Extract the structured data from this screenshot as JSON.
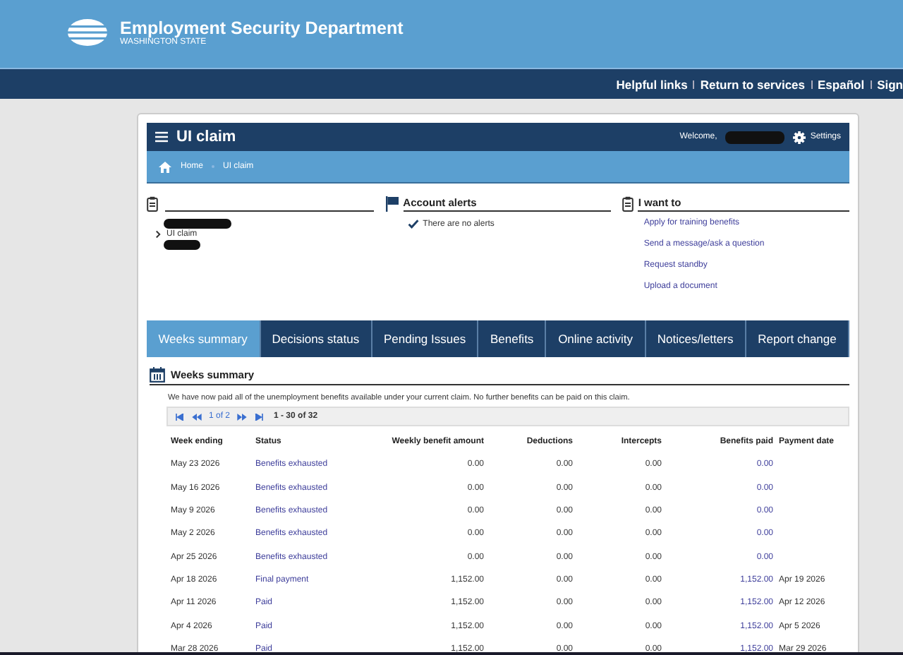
{
  "header": {
    "title": "Employment Security Department",
    "subtitle": "WASHINGTON STATE"
  },
  "top_links": [
    "Helpful links",
    "Return to services",
    "Español",
    "Sign"
  ],
  "claim_bar": {
    "title": "UI claim",
    "welcome": "Welcome,",
    "settings": "Settings"
  },
  "breadcrumb": [
    "Home",
    "UI claim"
  ],
  "account": {
    "claim_label": "UI claim"
  },
  "alerts": {
    "title": "Account alerts",
    "message": "There are no alerts"
  },
  "i_want_to": {
    "title": "I want to",
    "links": [
      "Apply for training benefits",
      "Send a message/ask a question",
      "Request standby",
      "Upload a document"
    ]
  },
  "tabs": [
    {
      "label": "Weeks summary",
      "selected": true
    },
    {
      "label": "Decisions status",
      "selected": false
    },
    {
      "label": "Pending Issues",
      "selected": false
    },
    {
      "label": "Benefits",
      "selected": false
    },
    {
      "label": "Online activity",
      "selected": false
    },
    {
      "label": "Notices/letters",
      "selected": false
    },
    {
      "label": "Report change",
      "selected": false
    }
  ],
  "section": {
    "title": "Weeks summary",
    "notice": "We have now paid all of the unemployment benefits available under your current claim. No further benefits can be paid on this claim."
  },
  "pager": {
    "page": "1 of 2",
    "range": "1 - 30 of 32"
  },
  "table": {
    "columns": [
      "Week ending",
      "Status",
      "Weekly benefit amount",
      "Deductions",
      "Intercepts",
      "Benefits paid",
      "Payment date"
    ],
    "rows": [
      {
        "week_ending": "May 23 2026",
        "status": "Benefits exhausted",
        "weekly_benefit_amount": "0.00",
        "deductions": "0.00",
        "intercepts": "0.00",
        "benefits_paid": "0.00",
        "payment_date": ""
      },
      {
        "week_ending": "May 16 2026",
        "status": "Benefits exhausted",
        "weekly_benefit_amount": "0.00",
        "deductions": "0.00",
        "intercepts": "0.00",
        "benefits_paid": "0.00",
        "payment_date": ""
      },
      {
        "week_ending": "May 9 2026",
        "status": "Benefits exhausted",
        "weekly_benefit_amount": "0.00",
        "deductions": "0.00",
        "intercepts": "0.00",
        "benefits_paid": "0.00",
        "payment_date": ""
      },
      {
        "week_ending": "May 2 2026",
        "status": "Benefits exhausted",
        "weekly_benefit_amount": "0.00",
        "deductions": "0.00",
        "intercepts": "0.00",
        "benefits_paid": "0.00",
        "payment_date": ""
      },
      {
        "week_ending": "Apr 25 2026",
        "status": "Benefits exhausted",
        "weekly_benefit_amount": "0.00",
        "deductions": "0.00",
        "intercepts": "0.00",
        "benefits_paid": "0.00",
        "payment_date": ""
      },
      {
        "week_ending": "Apr 18 2026",
        "status": "Final payment",
        "weekly_benefit_amount": "1,152.00",
        "deductions": "0.00",
        "intercepts": "0.00",
        "benefits_paid": "1,152.00",
        "payment_date": "Apr 19 2026"
      },
      {
        "week_ending": "Apr 11 2026",
        "status": "Paid",
        "weekly_benefit_amount": "1,152.00",
        "deductions": "0.00",
        "intercepts": "0.00",
        "benefits_paid": "1,152.00",
        "payment_date": "Apr 12 2026"
      },
      {
        "week_ending": "Apr 4 2026",
        "status": "Paid",
        "weekly_benefit_amount": "1,152.00",
        "deductions": "0.00",
        "intercepts": "0.00",
        "benefits_paid": "1,152.00",
        "payment_date": "Apr 5 2026"
      },
      {
        "week_ending": "Mar 28 2026",
        "status": "Paid",
        "weekly_benefit_amount": "1,152.00",
        "deductions": "0.00",
        "intercepts": "0.00",
        "benefits_paid": "1,152.00",
        "payment_date": "Mar 29 2026"
      }
    ]
  }
}
